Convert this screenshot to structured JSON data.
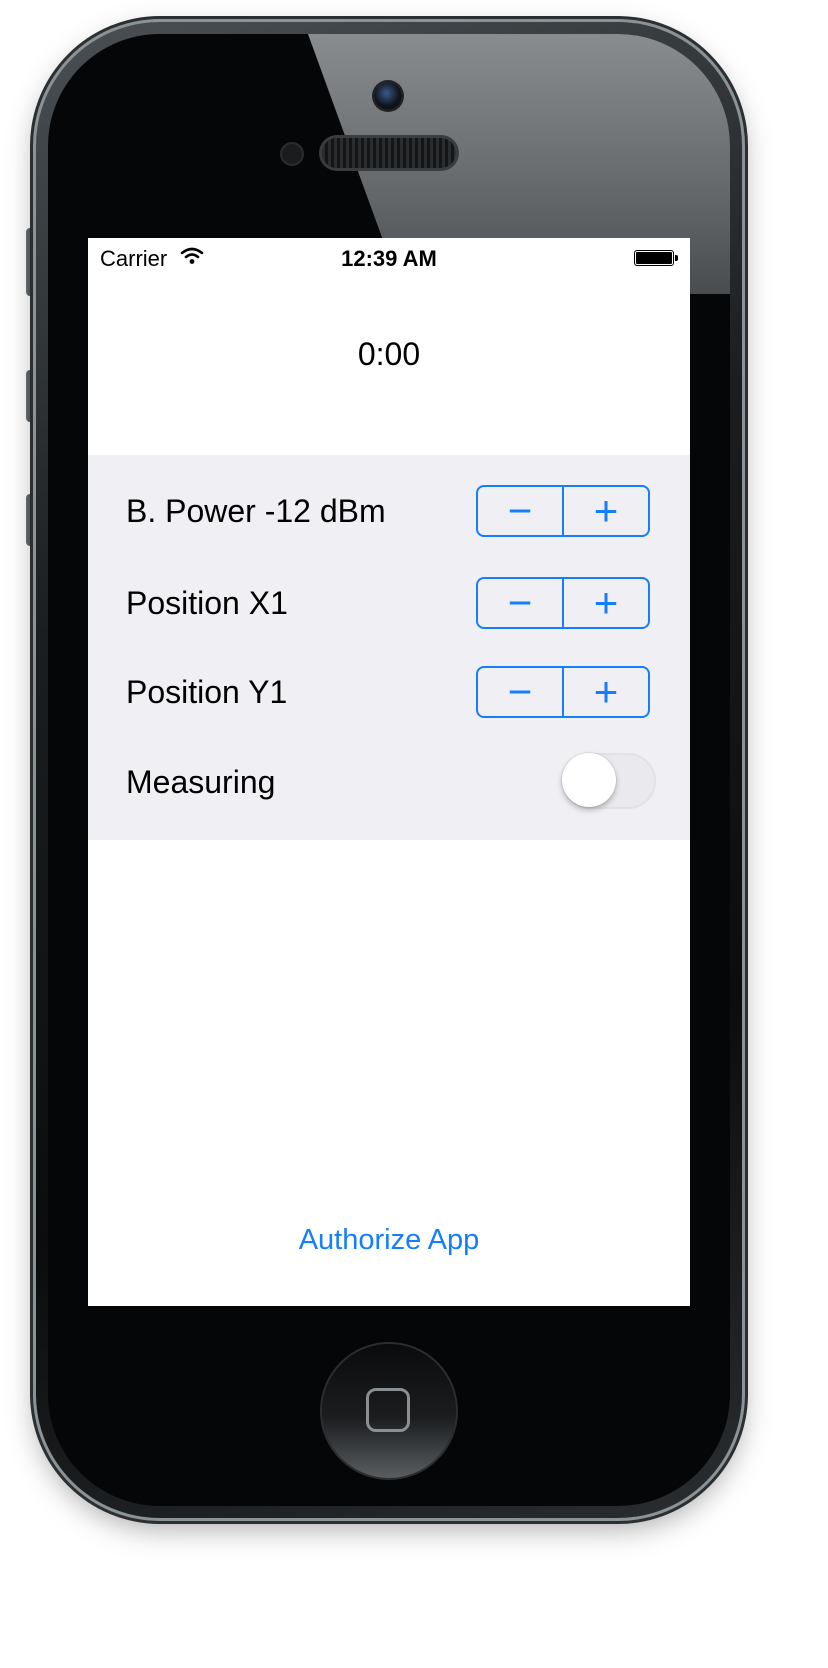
{
  "status_bar": {
    "carrier": "Carrier",
    "time": "12:39 AM",
    "wifi_icon": "wifi-icon",
    "battery_icon": "battery-icon"
  },
  "timer": "0:00",
  "controls": {
    "power_label": "B. Power -12 dBm",
    "position_x_label": "Position X1",
    "position_y_label": "Position Y1",
    "measuring_label": "Measuring",
    "measuring_on": false,
    "stepper_minus": "−",
    "stepper_plus": "+"
  },
  "authorize_button": "Authorize App",
  "colors": {
    "accent": "#147efb",
    "panel_background": "#efeff4"
  }
}
